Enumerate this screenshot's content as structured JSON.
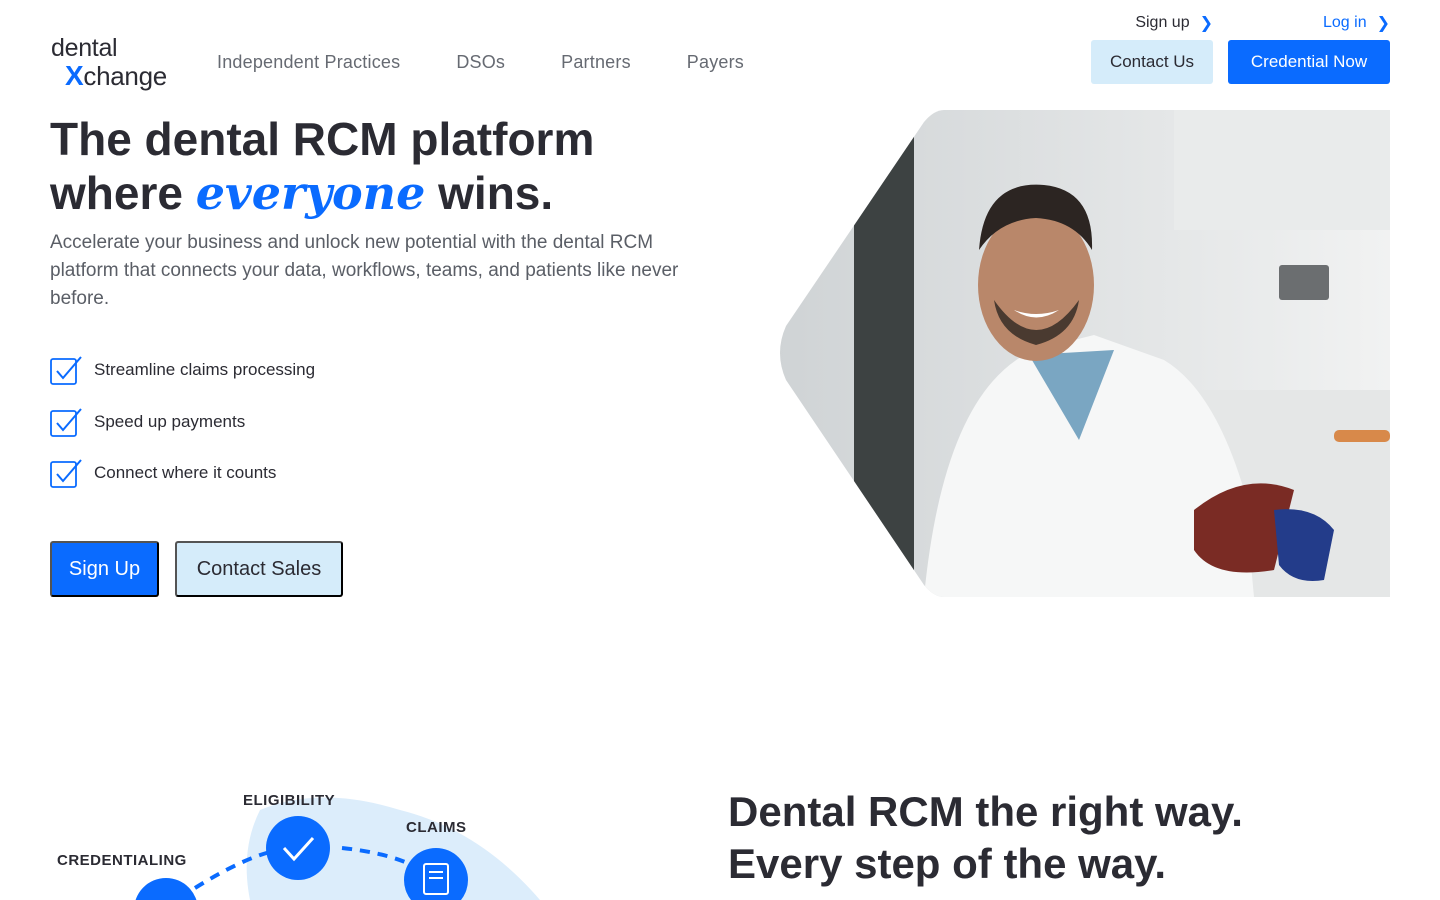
{
  "logo": {
    "line1": "dental",
    "x_letter": "X",
    "line2_rest": "change"
  },
  "nav": {
    "items": [
      "Independent Practices",
      "DSOs",
      "Partners",
      "Payers"
    ]
  },
  "toplinks": {
    "signup": "Sign up",
    "login": "Log in",
    "chevron": "❯"
  },
  "header_buttons": {
    "contact": "Contact Us",
    "credential": "Credential Now"
  },
  "hero": {
    "title_line1": "The dental RCM platform",
    "title_line2_pre": "where ",
    "title_emphasis": "everyone",
    "title_line2_post": " wins.",
    "subtitle": "Accelerate your business and unlock new potential with the dental RCM platform that connects your data, workflows, teams, and patients like never before.",
    "checks": [
      "Streamline claims processing",
      "Speed up payments",
      "Connect where it counts"
    ],
    "primary_button": "Sign Up",
    "secondary_button": "Contact Sales"
  },
  "section2": {
    "title_line1": "Dental RCM the right way.",
    "title_line2": "Every step of the way.",
    "diagram_labels": {
      "credentialing": "CREDENTIALING",
      "eligibility": "ELIGIBILITY",
      "claims": "CLAIMS"
    }
  },
  "colors": {
    "accent": "#0a6bff",
    "light_accent": "#d5ecfa",
    "text": "#2b2b33"
  },
  "icons": {
    "check": "checkbox-check-icon",
    "eligibility": "check-circle-icon",
    "claims": "document-icon",
    "credentialing": "badge-icon"
  }
}
